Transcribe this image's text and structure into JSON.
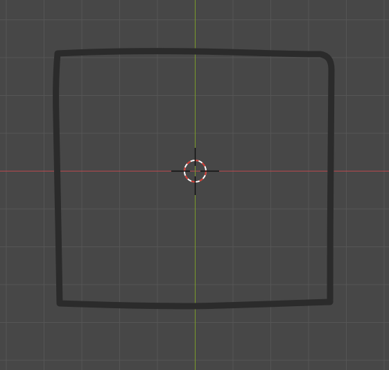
{
  "viewport": {
    "background_color": "#474747",
    "grid_color": "#555555",
    "x_axis_color": "#b5484d",
    "y_axis_color": "#7a9a2a",
    "stroke_color": "#2b2b2b",
    "cursor": {
      "icon": "3d-cursor-icon",
      "ring_primary_color": "#ffffff",
      "ring_secondary_color": "#d23a32",
      "crosshair_color": "#111111"
    },
    "sketch": {
      "icon": "drawn-square-stroke"
    }
  }
}
